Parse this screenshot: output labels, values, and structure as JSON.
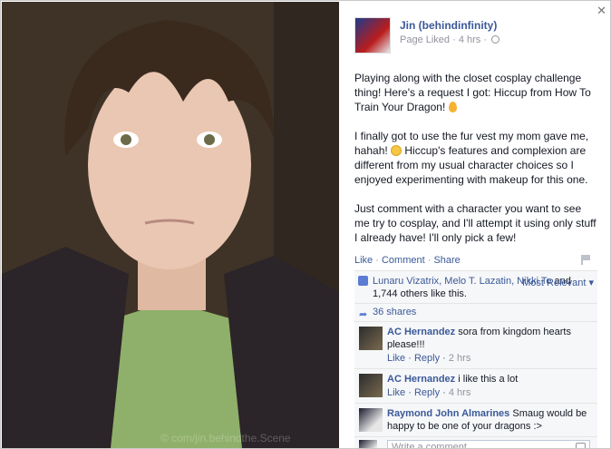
{
  "photo": {
    "watermark": "© com/jin.behindthe.Scene"
  },
  "post": {
    "page_name": "Jin (behindinfinity)",
    "meta_liked": "Page Liked",
    "meta_time": "4 hrs",
    "paragraph_1": "Playing along with the closet cosplay challenge thing! Here's a request I got: Hiccup from How To Train Your Dragon!",
    "paragraph_2a": "I finally got to use the fur vest my mom gave me, hahah!",
    "paragraph_2b": "Hiccup's features and complexion are different from my usual character choices so I enjoyed experimenting with makeup for this one.",
    "paragraph_3": "Just comment with a character you want to see me try to cosplay, and I'll attempt it using only stuff I already have! I'll only pick a few!"
  },
  "actions": {
    "like": "Like",
    "comment": "Comment",
    "share": "Share",
    "sep": " · "
  },
  "ufi": {
    "likers": "Lunaru Vizatrix, Melo T. Lazatin, Nikki Te",
    "likers_rest": "and 1,744 others like this.",
    "most_relevant": "Most Relevant",
    "shares": "36 shares"
  },
  "comments": [
    {
      "name": "AC Hernandez",
      "text": "sora from kingdom hearts please!!!",
      "like": "Like",
      "reply": "Reply",
      "time": "2 hrs"
    },
    {
      "name": "AC Hernandez",
      "text": "i like this a lot",
      "like": "Like",
      "reply": "Reply",
      "time": "4 hrs"
    },
    {
      "name": "Raymond John Almarines",
      "text": "Smaug would be happy to be one of your dragons :>"
    }
  ],
  "write_comment": {
    "placeholder": "Write a comment..."
  },
  "icons": {
    "close": "close-icon",
    "globe": "globe-icon",
    "flag": "flag-icon",
    "thumb": "thumbs-up-icon",
    "share": "share-icon",
    "camera": "camera-icon"
  },
  "colors": {
    "link": "#3b5998",
    "muted": "#90949c",
    "ufi_bg": "#f6f7f9"
  }
}
